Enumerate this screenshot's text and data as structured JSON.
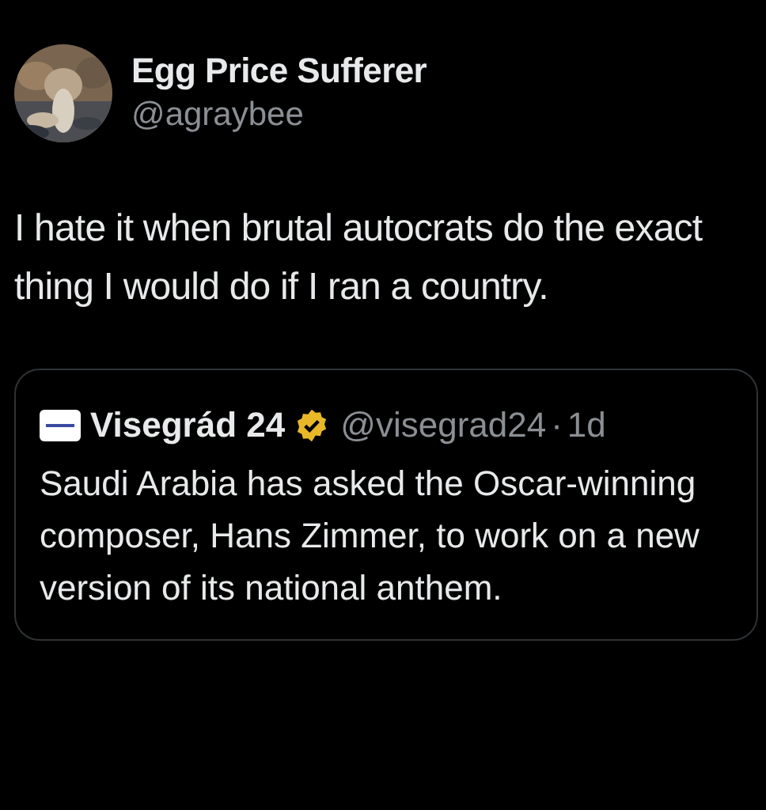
{
  "author": {
    "name": "Egg Price Sufferer",
    "handle": "@agraybee"
  },
  "text": "I hate it when brutal autocrats do the exact thing I would do if I ran a country.",
  "quote": {
    "name": "Visegrád 24",
    "verified": true,
    "handle": "@visegrad24",
    "separator": "·",
    "time": "1d",
    "text": "Saudi Arabia has asked the Oscar-winning composer, Hans Zimmer, to work on a new version of its national anthem."
  }
}
